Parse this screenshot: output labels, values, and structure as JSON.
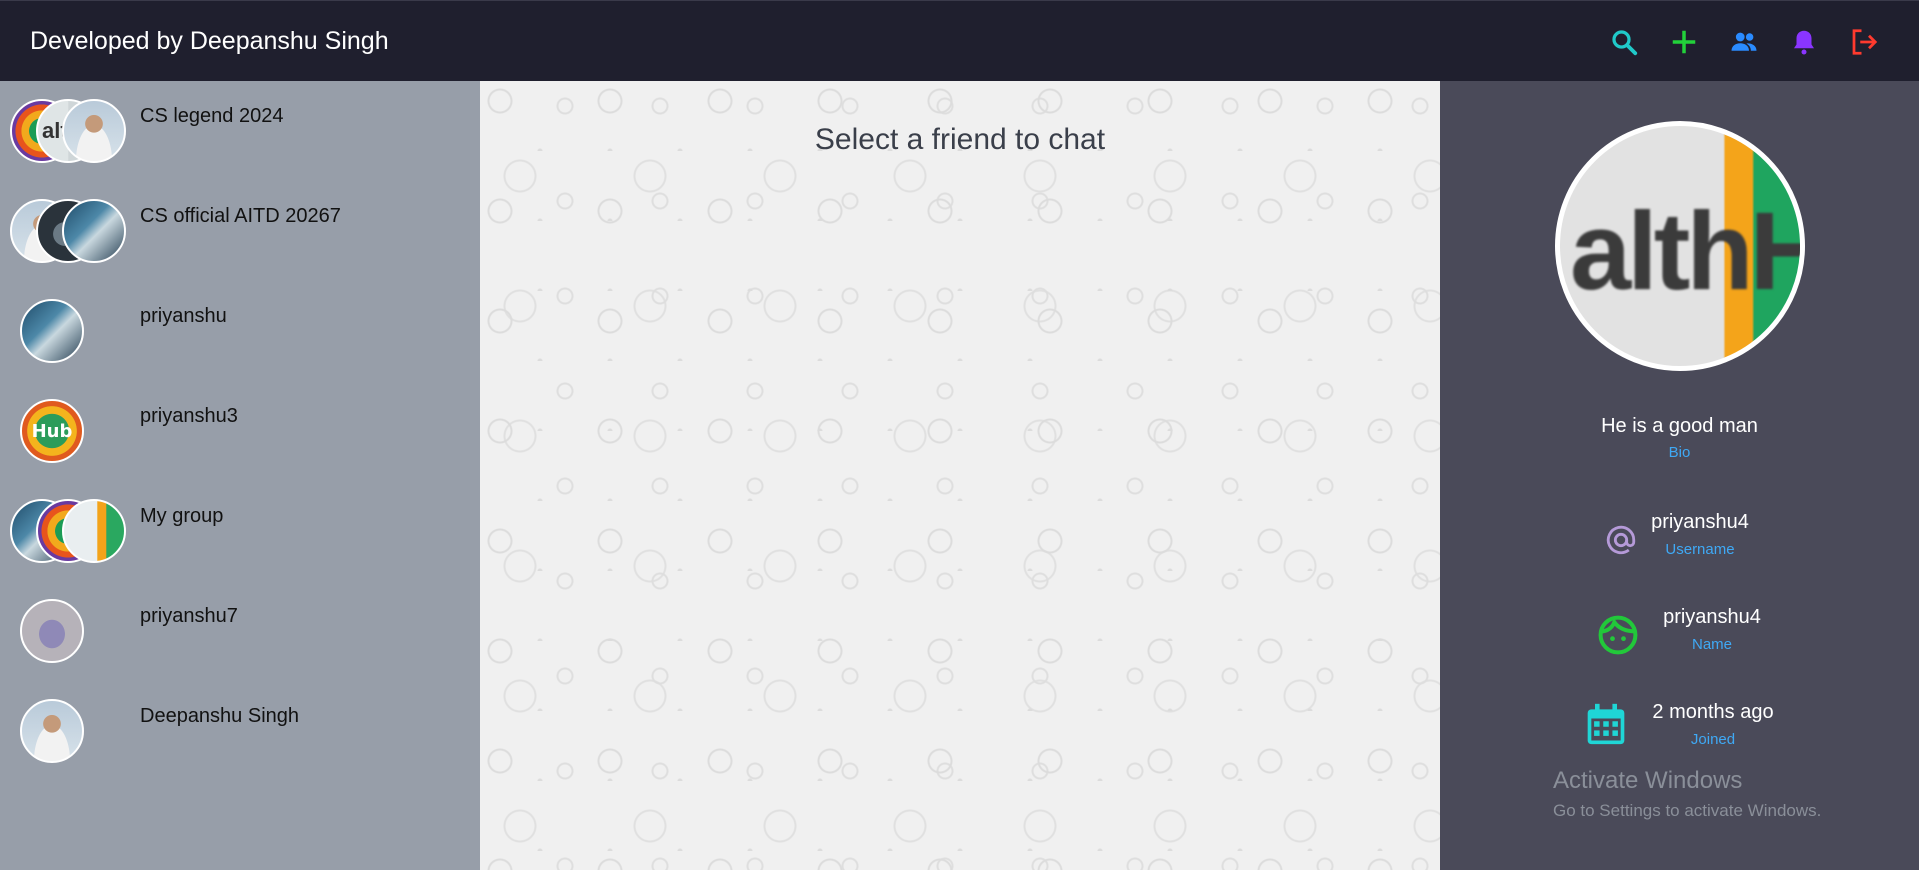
{
  "header": {
    "brand": "Developed by Deepanshu Singh",
    "actions": [
      {
        "icon": "search-icon",
        "color": "#20c9c9"
      },
      {
        "icon": "plus-icon",
        "color": "#22d13a"
      },
      {
        "icon": "users-icon",
        "color": "#2a8bff"
      },
      {
        "icon": "bell-icon",
        "color": "#8a35ff"
      },
      {
        "icon": "logout-icon",
        "color": "#ff3a2e"
      }
    ]
  },
  "sidebar": {
    "chats": [
      {
        "name": "CS legend 2024",
        "type": "group"
      },
      {
        "name": "CS official AITD 20267",
        "type": "group"
      },
      {
        "name": "priyanshu",
        "type": "user"
      },
      {
        "name": "priyanshu3",
        "type": "user",
        "avatar_text": "Hub"
      },
      {
        "name": "My group",
        "type": "group"
      },
      {
        "name": "priyanshu7",
        "type": "user"
      },
      {
        "name": "Deepanshu Singh",
        "type": "user"
      }
    ]
  },
  "main": {
    "placeholder": "Select a friend to chat"
  },
  "profile": {
    "avatar_text": "althH",
    "bio": {
      "value": "He is a good man",
      "label": "Bio"
    },
    "username": {
      "value": "priyanshu4",
      "label": "Username",
      "icon": "at-icon",
      "color": "#b59ad8"
    },
    "name": {
      "value": "priyanshu4",
      "label": "Name",
      "icon": "face-icon",
      "color": "#22c83a"
    },
    "joined": {
      "value": "2 months ago",
      "label": "Joined",
      "icon": "calendar-icon",
      "color": "#1fd6d6"
    }
  },
  "watermark": {
    "title": "Activate Windows",
    "subtitle": "Go to Settings to activate Windows."
  }
}
